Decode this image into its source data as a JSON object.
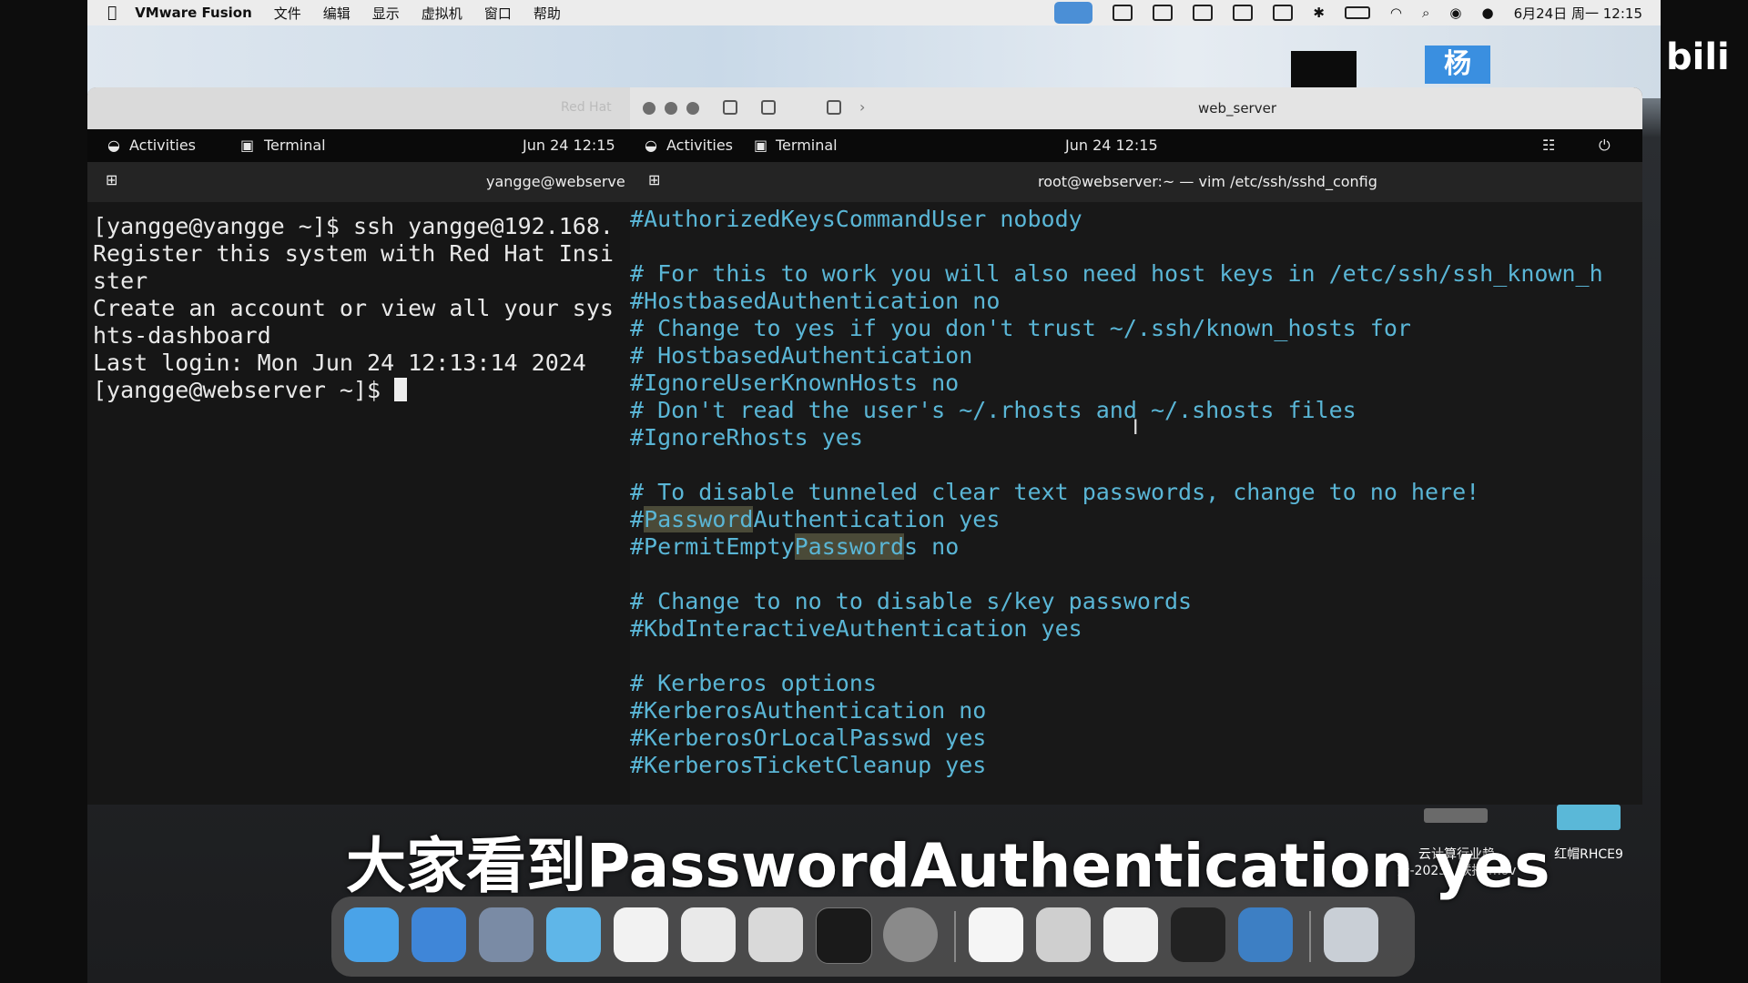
{
  "menubar": {
    "app_name": "VMware Fusion",
    "menus": [
      "文件",
      "编辑",
      "显示",
      "虚拟机",
      "窗口",
      "帮助"
    ],
    "datetime": "6月24日 周一  12:15"
  },
  "banner": {
    "badge": "杨",
    "brand": "bili"
  },
  "vm": {
    "tab_name": "Red Hat",
    "window_title": "web_server"
  },
  "left_pane": {
    "activities": "Activities",
    "terminal": "Terminal",
    "datetime": "Jun 24  12:15",
    "header": "yangge@webserve",
    "lines": [
      "[yangge@yangge ~]$ ssh yangge@192.168.",
      "Register this system with Red Hat Insi",
      "ster",
      "Create an account or view all your sys",
      "hts-dashboard",
      "Last login: Mon Jun 24 12:13:14 2024",
      "[yangge@webserver ~]$ "
    ]
  },
  "right_pane": {
    "activities": "Activities",
    "terminal": "Terminal",
    "datetime": "Jun 24  12:15",
    "header": "root@webserver:~ — vim /etc/ssh/sshd_config",
    "lines": [
      "#AuthorizedKeysCommandUser nobody",
      "",
      "# For this to work you will also need host keys in /etc/ssh/ssh_known_h",
      "#HostbasedAuthentication no",
      "# Change to yes if you don't trust ~/.ssh/known_hosts for",
      "# HostbasedAuthentication",
      "#IgnoreUserKnownHosts no",
      "# Don't read the user's ~/.rhosts and ~/.shosts files",
      "#IgnoreRhosts yes",
      "",
      "# To disable tunneled clear text passwords, change to no here!",
      "",
      "",
      "",
      "# Change to no to disable s/key passwords",
      "#KbdInteractiveAuthentication yes",
      "",
      "# Kerberos options",
      "#KerberosAuthentication no",
      "#KerberosOrLocalPasswd yes",
      "#KerberosTicketCleanup yes"
    ],
    "hl_line1": {
      "pre": "#",
      "hl": "Password",
      "post": "Authentication yes"
    },
    "hl_line2": {
      "pre": "#PermitEmpty",
      "hl": "Password",
      "post": "s no"
    }
  },
  "subtitle": "大家看到PasswordAuthentication yes",
  "desktop_files": [
    {
      "label": "云计算行业趋\n势-2023...联播.mov"
    },
    {
      "label": "红帽RHCE9"
    }
  ],
  "dock_icons": [
    "finder-icon",
    "safari-icon",
    "launchpad-icon",
    "preview-icon",
    "pen-icon",
    "freeform-icon",
    "folder-icon",
    "terminal-icon",
    "screenshot-icon",
    "typora-icon",
    "pdf-icon",
    "wps-icon",
    "chatbot-icon",
    "vmware-icon",
    "trash-icon"
  ],
  "colors": {
    "vim_comment": "#5ab6d6",
    "search_highlight": "#4a4a38",
    "terminal_bg": "#181818"
  }
}
